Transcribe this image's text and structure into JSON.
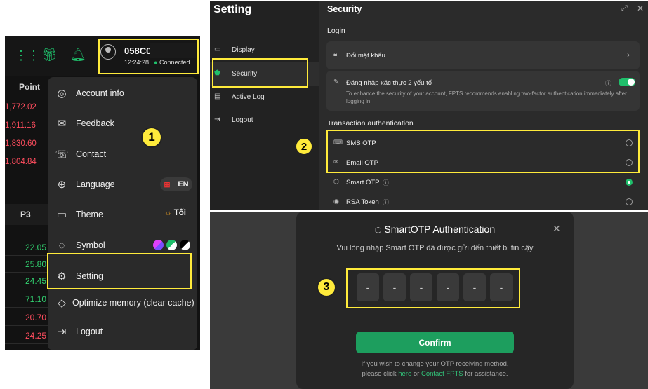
{
  "panel1": {
    "account_id": "058C0",
    "time": "12:24:28",
    "status": "Connected",
    "point_header": "Point",
    "point_values": [
      "1,772.02",
      "1,911.16",
      "1,830.60",
      "1,804.84"
    ],
    "p3_header": "P3",
    "p3_values": [
      {
        "v": "22.05",
        "c": "green"
      },
      {
        "v": "25.80",
        "c": "green"
      },
      {
        "v": "24.45",
        "c": "green"
      },
      {
        "v": "71.10",
        "c": "green"
      },
      {
        "v": "20.70",
        "c": "red"
      },
      {
        "v": "24.25",
        "c": "red"
      }
    ],
    "menu": {
      "account_info": "Account info",
      "feedback": "Feedback",
      "contact": "Contact",
      "language": "Language",
      "language_value": "EN",
      "theme": "Theme",
      "theme_value": "Tối",
      "symbol": "Symbol",
      "setting": "Setting",
      "optimize": "Optimize memory (clear cache)",
      "logout": "Logout"
    },
    "step_badge": "1"
  },
  "panel2": {
    "title": "Setting",
    "sidebar": [
      "Display",
      "Security",
      "Active Log",
      "Logout"
    ],
    "section_title": "Security",
    "login_header": "Login",
    "change_password": "Đổi mật khẩu",
    "two_factor_title": "Đăng nhập xác thực 2 yếu tố",
    "two_factor_desc": "To enhance the security of your account, FPTS recommends enabling two-factor authentication immediately after logging in.",
    "transaction_header": "Transaction authentication",
    "options": [
      "SMS OTP",
      "Email OTP",
      "Smart OTP",
      "RSA Token"
    ],
    "selected_option": "Smart OTP",
    "step_badge": "2"
  },
  "panel3": {
    "dialog_title": "SmartOTP Authentication",
    "instruction": "Vui lòng nhập Smart OTP đã được gửi đến thiết bị tin cậy",
    "otp_digits": [
      "-",
      "-",
      "-",
      "-",
      "-",
      "-"
    ],
    "confirm_label": "Confirm",
    "help_line1": "If you wish to change your OTP receiving method,",
    "help_line2_a": "please click ",
    "help_link1": "here",
    "help_line2_b": " or ",
    "help_link2": "Contact FPTS",
    "help_line2_c": " for assistance.",
    "step_badge": "3"
  },
  "colors": {
    "accent_green": "#1fbf6b",
    "highlight_yellow": "#ffeb3b",
    "negative_red": "#ff4d5e"
  }
}
